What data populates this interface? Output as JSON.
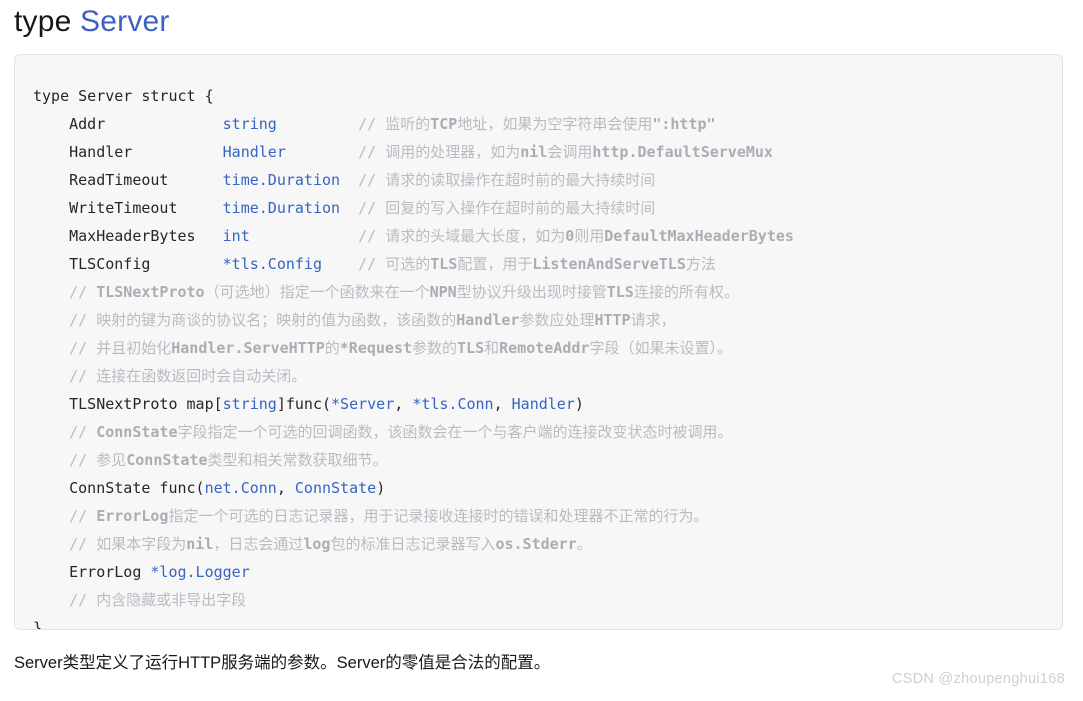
{
  "heading": {
    "keyword": "type ",
    "type_name": "Server"
  },
  "code": {
    "language": "go",
    "colors": {
      "background": "#f7f7f8",
      "border": "#e3e3e5",
      "plain_text": "#23262b",
      "type_token": "#3465c0",
      "comment_text": "#b8bcc2",
      "heading_type": "#3f62bf"
    },
    "lines": [
      [
        {
          "text": "type Server struct {",
          "style": "plain"
        }
      ],
      [
        {
          "text": "    Addr             ",
          "style": "plain"
        },
        {
          "text": "string",
          "style": "type"
        },
        {
          "text": "         ",
          "style": "plain"
        },
        {
          "text": "// ",
          "style": "comment"
        },
        {
          "text": "监听的",
          "style": "comment"
        },
        {
          "text": "TCP",
          "style": "comment-bold"
        },
        {
          "text": "地址，如果为空字符串会使用",
          "style": "comment"
        },
        {
          "text": "\":http\"",
          "style": "comment-bold"
        }
      ],
      [
        {
          "text": "    Handler          ",
          "style": "plain"
        },
        {
          "text": "Handler",
          "style": "type"
        },
        {
          "text": "        ",
          "style": "plain"
        },
        {
          "text": "// ",
          "style": "comment"
        },
        {
          "text": "调用的处理器，如为",
          "style": "comment"
        },
        {
          "text": "nil",
          "style": "comment-bold"
        },
        {
          "text": "会调用",
          "style": "comment"
        },
        {
          "text": "http.DefaultServeMux",
          "style": "comment-bold"
        }
      ],
      [
        {
          "text": "    ReadTimeout      ",
          "style": "plain"
        },
        {
          "text": "time.Duration",
          "style": "type"
        },
        {
          "text": "  ",
          "style": "plain"
        },
        {
          "text": "// ",
          "style": "comment"
        },
        {
          "text": "请求的读取操作在超时前的最大持续时间",
          "style": "comment"
        }
      ],
      [
        {
          "text": "    WriteTimeout     ",
          "style": "plain"
        },
        {
          "text": "time.Duration",
          "style": "type"
        },
        {
          "text": "  ",
          "style": "plain"
        },
        {
          "text": "// ",
          "style": "comment"
        },
        {
          "text": "回复的写入操作在超时前的最大持续时间",
          "style": "comment"
        }
      ],
      [
        {
          "text": "    MaxHeaderBytes   ",
          "style": "plain"
        },
        {
          "text": "int",
          "style": "type"
        },
        {
          "text": "            ",
          "style": "plain"
        },
        {
          "text": "// ",
          "style": "comment"
        },
        {
          "text": "请求的头域最大长度，如为",
          "style": "comment"
        },
        {
          "text": "0",
          "style": "comment-bold"
        },
        {
          "text": "则用",
          "style": "comment"
        },
        {
          "text": "DefaultMaxHeaderBytes",
          "style": "comment-bold"
        }
      ],
      [
        {
          "text": "    TLSConfig        ",
          "style": "plain"
        },
        {
          "text": "*tls.Config",
          "style": "type"
        },
        {
          "text": "    ",
          "style": "plain"
        },
        {
          "text": "// ",
          "style": "comment"
        },
        {
          "text": "可选的",
          "style": "comment"
        },
        {
          "text": "TLS",
          "style": "comment-bold"
        },
        {
          "text": "配置，用于",
          "style": "comment"
        },
        {
          "text": "ListenAndServeTLS",
          "style": "comment-bold"
        },
        {
          "text": "方法",
          "style": "comment"
        }
      ],
      [
        {
          "text": "    // ",
          "style": "comment"
        },
        {
          "text": "TLSNextProto",
          "style": "comment-bold"
        },
        {
          "text": "（可选地）指定一个函数来在一个",
          "style": "comment"
        },
        {
          "text": "NPN",
          "style": "comment-bold"
        },
        {
          "text": "型协议升级出现时接管",
          "style": "comment"
        },
        {
          "text": "TLS",
          "style": "comment-bold"
        },
        {
          "text": "连接的所有权。",
          "style": "comment"
        }
      ],
      [
        {
          "text": "    // ",
          "style": "comment"
        },
        {
          "text": "映射的键为商谈的协议名；映射的值为函数，该函数的",
          "style": "comment"
        },
        {
          "text": "Handler",
          "style": "comment-bold"
        },
        {
          "text": "参数应处理",
          "style": "comment"
        },
        {
          "text": "HTTP",
          "style": "comment-bold"
        },
        {
          "text": "请求，",
          "style": "comment"
        }
      ],
      [
        {
          "text": "    // ",
          "style": "comment"
        },
        {
          "text": "并且初始化",
          "style": "comment"
        },
        {
          "text": "Handler.ServeHTTP",
          "style": "comment-bold"
        },
        {
          "text": "的",
          "style": "comment"
        },
        {
          "text": "*Request",
          "style": "comment-bold"
        },
        {
          "text": "参数的",
          "style": "comment"
        },
        {
          "text": "TLS",
          "style": "comment-bold"
        },
        {
          "text": "和",
          "style": "comment"
        },
        {
          "text": "RemoteAddr",
          "style": "comment-bold"
        },
        {
          "text": "字段（如果未设置）。",
          "style": "comment"
        }
      ],
      [
        {
          "text": "    // ",
          "style": "comment"
        },
        {
          "text": "连接在函数返回时会自动关闭。",
          "style": "comment"
        }
      ],
      [
        {
          "text": "    TLSNextProto map[",
          "style": "plain"
        },
        {
          "text": "string",
          "style": "type"
        },
        {
          "text": "]func(",
          "style": "plain"
        },
        {
          "text": "*Server",
          "style": "type"
        },
        {
          "text": ", ",
          "style": "plain"
        },
        {
          "text": "*tls.Conn",
          "style": "type"
        },
        {
          "text": ", ",
          "style": "plain"
        },
        {
          "text": "Handler",
          "style": "type"
        },
        {
          "text": ")",
          "style": "plain"
        }
      ],
      [
        {
          "text": "    // ",
          "style": "comment"
        },
        {
          "text": "ConnState",
          "style": "comment-bold"
        },
        {
          "text": "字段指定一个可选的回调函数，该函数会在一个与客户端的连接改变状态时被调用。",
          "style": "comment"
        }
      ],
      [
        {
          "text": "    // ",
          "style": "comment"
        },
        {
          "text": "参见",
          "style": "comment"
        },
        {
          "text": "ConnState",
          "style": "comment-bold"
        },
        {
          "text": "类型和相关常数获取细节。",
          "style": "comment"
        }
      ],
      [
        {
          "text": "    ConnState func(",
          "style": "plain"
        },
        {
          "text": "net.Conn",
          "style": "type"
        },
        {
          "text": ", ",
          "style": "plain"
        },
        {
          "text": "ConnState",
          "style": "type"
        },
        {
          "text": ")",
          "style": "plain"
        }
      ],
      [
        {
          "text": "    // ",
          "style": "comment"
        },
        {
          "text": "ErrorLog",
          "style": "comment-bold"
        },
        {
          "text": "指定一个可选的日志记录器，用于记录接收连接时的错误和处理器不正常的行为。",
          "style": "comment"
        }
      ],
      [
        {
          "text": "    // ",
          "style": "comment"
        },
        {
          "text": "如果本字段为",
          "style": "comment"
        },
        {
          "text": "nil",
          "style": "comment-bold"
        },
        {
          "text": "，日志会通过",
          "style": "comment"
        },
        {
          "text": "log",
          "style": "comment-bold"
        },
        {
          "text": "包的标准日志记录器写入",
          "style": "comment"
        },
        {
          "text": "os.Stderr",
          "style": "comment-bold"
        },
        {
          "text": "。",
          "style": "comment"
        }
      ],
      [
        {
          "text": "    ErrorLog ",
          "style": "plain"
        },
        {
          "text": "*log.Logger",
          "style": "type"
        }
      ],
      [
        {
          "text": "    // ",
          "style": "comment"
        },
        {
          "text": "内含隐藏或非导出字段",
          "style": "comment"
        }
      ],
      [
        {
          "text": "}",
          "style": "plain"
        }
      ]
    ]
  },
  "description": "Server类型定义了运行HTTP服务端的参数。Server的零值是合法的配置。",
  "watermark": "CSDN @zhoupenghui168"
}
